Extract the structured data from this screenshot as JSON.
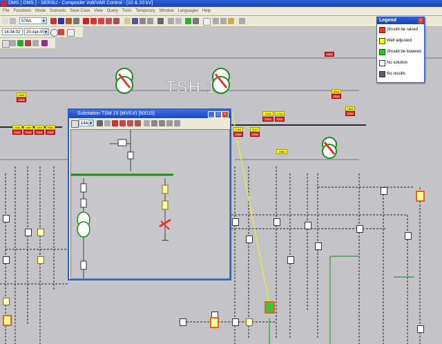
{
  "window": {
    "title": "DMS [ DMS ] - SERSU - Composite Volt/VAR Control - [10 & 20 kV]"
  },
  "menu": [
    "File",
    "Functions",
    "Mode",
    "Scenario",
    "Save Case",
    "View",
    "Query",
    "Tools",
    "Temporary",
    "Window",
    "Languages",
    "Help"
  ],
  "toolbar": {
    "voltage_value": "576/L",
    "time_value": "16:34:02",
    "date_value": "20-Apr-09"
  },
  "legend": {
    "title": "Legend",
    "items": [
      {
        "label": "Should be raised",
        "color": "#e8322a"
      },
      {
        "label": "Well adjusted",
        "color": "#ffff00"
      },
      {
        "label": "Should be lowered",
        "color": "#22cc22"
      },
      {
        "label": "No solution",
        "color": "#ffffff"
      },
      {
        "label": "No results",
        "color": "#606060"
      }
    ]
  },
  "substation_window": {
    "title": "Substation TSM 15 (MV/LV) [50015]",
    "combo_value": "144/L"
  },
  "diagram": {
    "main_label": "TSH 1"
  },
  "colors": {
    "accent_blue": "#2a5fd8",
    "bus_green": "#1a8a1a",
    "feeder_yellow": "#ffff00",
    "raise_red": "#e8322a"
  },
  "tags": {
    "t1": "16kA",
    "t2": "18kA",
    "t3": "10kA",
    "t4": "12kV",
    "t5": "14kV",
    "t6": "16kA",
    "t7": "20kV",
    "t8": "15kA",
    "t9": "30kA",
    "t10": "19kA",
    "t11": "16kA",
    "t12": "12kA",
    "t13": "16kA",
    "t14": "17kA",
    "t15": "10kA",
    "t16": "14kA",
    "t17": "20kA",
    "t18": "21kV",
    "t19": "19kA",
    "t20": "30kA",
    "t21": "16kA",
    "t22": "16kA",
    "t23": "12kV",
    "t24": "18kA"
  }
}
